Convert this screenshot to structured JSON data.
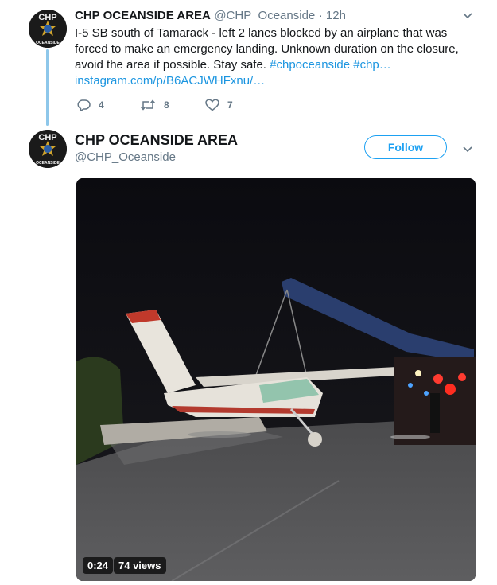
{
  "tweet1": {
    "name": "CHP OCEANSIDE AREA",
    "handle": "@CHP_Oceanside",
    "time": "· 12h",
    "text": "I-5 SB south of Tamarack - left 2 lanes blocked by an airplane that was forced to make an emergency landing.  Unknown duration on the closure, avoid the area if possible.  Stay safe.",
    "hashtags": "#chpoceanside #chp…",
    "link": "instagram.com/p/B6ACJWHFxnu/…",
    "replies": "4",
    "retweets": "8",
    "likes": "7"
  },
  "tweet2": {
    "name": "CHP OCEANSIDE AREA",
    "handle": "@CHP_Oceanside",
    "follow_label": "Follow",
    "video": {
      "duration": "0:24",
      "views": "74 views"
    }
  },
  "avatar": {
    "top_text": "CHP",
    "bottom_text": "OCEANSIDE"
  },
  "colors": {
    "accent": "#1da1f2",
    "link": "#1b95e0",
    "muted": "#657786",
    "thread_line": "#8ec7ea"
  }
}
